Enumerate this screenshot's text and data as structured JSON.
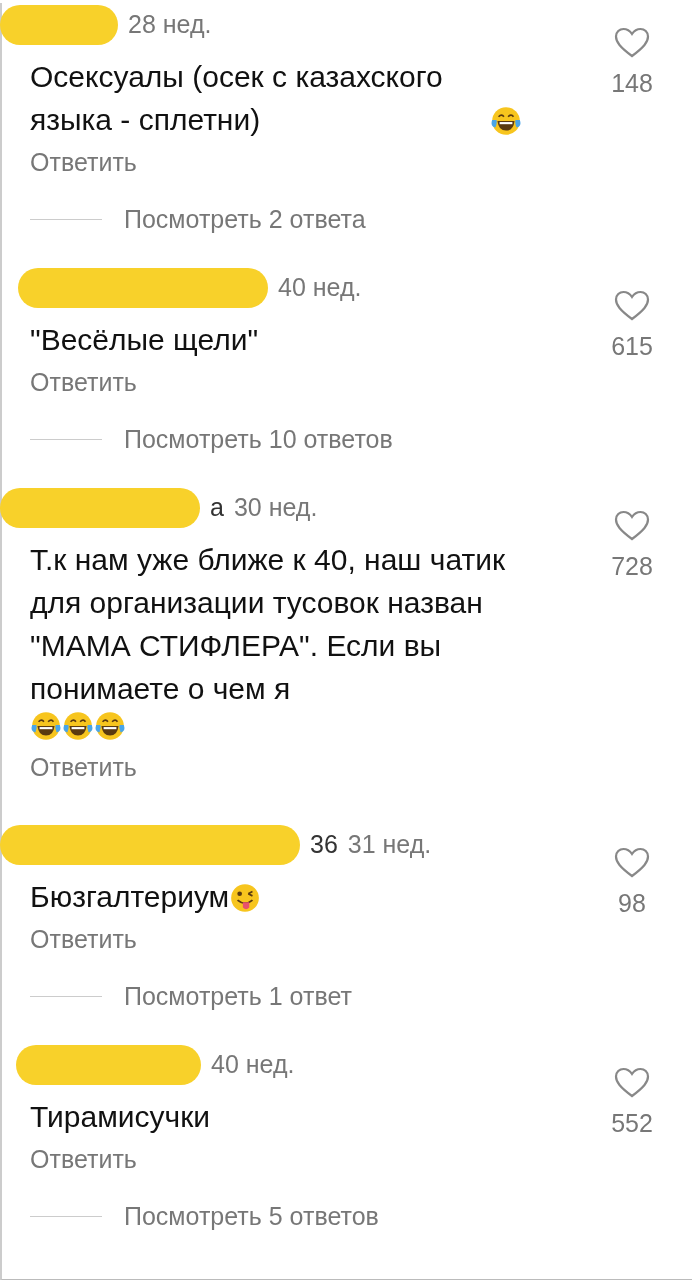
{
  "comments": [
    {
      "redacted": true,
      "time": "28 нед.",
      "text": "Осексуалы (осек с казахского языка - сплетни)",
      "emoji": [
        {
          "kind": "tears-of-joy"
        }
      ],
      "reply": "Ответить",
      "likes": "148",
      "replies": "Посмотреть 2 ответа"
    },
    {
      "redacted": true,
      "time": "40 нед.",
      "text": "\"Весёлые щели\"",
      "reply": "Ответить",
      "likes": "615",
      "replies": "Посмотреть 10 ответов"
    },
    {
      "redacted": true,
      "username": "а",
      "time": "30 нед.",
      "text": "Т.к нам уже ближе к 40, наш чатик для организации тусовок назван \"МАМА СТИФЛЕРА\". Если вы понимаете о чем я",
      "emoji": [
        {
          "kind": "tears-of-joy"
        },
        {
          "kind": "tears-of-joy"
        },
        {
          "kind": "tears-of-joy"
        }
      ],
      "reply": "Ответить",
      "likes": "728"
    },
    {
      "redacted": true,
      "username": "36",
      "time": "31 нед.",
      "text": "Бюзгалтериум",
      "emoji": [
        {
          "kind": "winking-tongue"
        }
      ],
      "reply": "Ответить",
      "likes": "98",
      "replies": "Посмотреть 1 ответ"
    },
    {
      "redacted": true,
      "time": "40 нед.",
      "text": "Тирамисучки",
      "reply": "Ответить",
      "likes": "552",
      "replies": "Посмотреть 5 ответов"
    }
  ]
}
